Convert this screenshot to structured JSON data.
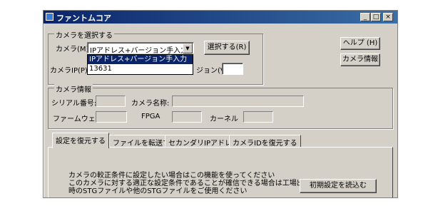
{
  "window": {
    "title": "ファントムコア",
    "controls": {
      "minimize": "_",
      "maximize": "□",
      "close": "×"
    }
  },
  "camera_select": {
    "group_label": "カメラを選択する",
    "camera_label": "カメラ(M):",
    "camera_value": "IPアドレス+バージョン手入力",
    "dropdown_options": [
      "IPアドレス+バージョン手入力",
      "13631"
    ],
    "select_button": "選択する(R)",
    "camera_ip_label": "カメラIP(P):",
    "version_label": "ジョン(V):"
  },
  "side_buttons": {
    "help": "ヘルプ (H)",
    "camera_info": "カメラ情報"
  },
  "camera_info": {
    "group_label": "カメラ情報",
    "serial_label": "シリアル番号:",
    "camera_name_label": "カメラ名称:",
    "firmware_label": "ファームウェア",
    "fpga_label": "FPGA",
    "kernel_label": "カーネル"
  },
  "tabs": [
    "設定を復元する",
    "ファイルを転送する",
    "セカンダリIPアドレス",
    "カメラIDを復元する"
  ],
  "panel": {
    "description_lines": [
      "カメラの較正条件に設定したい場合はこの機能を使ってください",
      "このカメラに対する適正な設定条件であることが確信できる場合は工場出荷",
      "時のSTGファイルや他のSTGファイルをご使用ください"
    ],
    "load_defaults_button": "初期設定を読込む"
  }
}
